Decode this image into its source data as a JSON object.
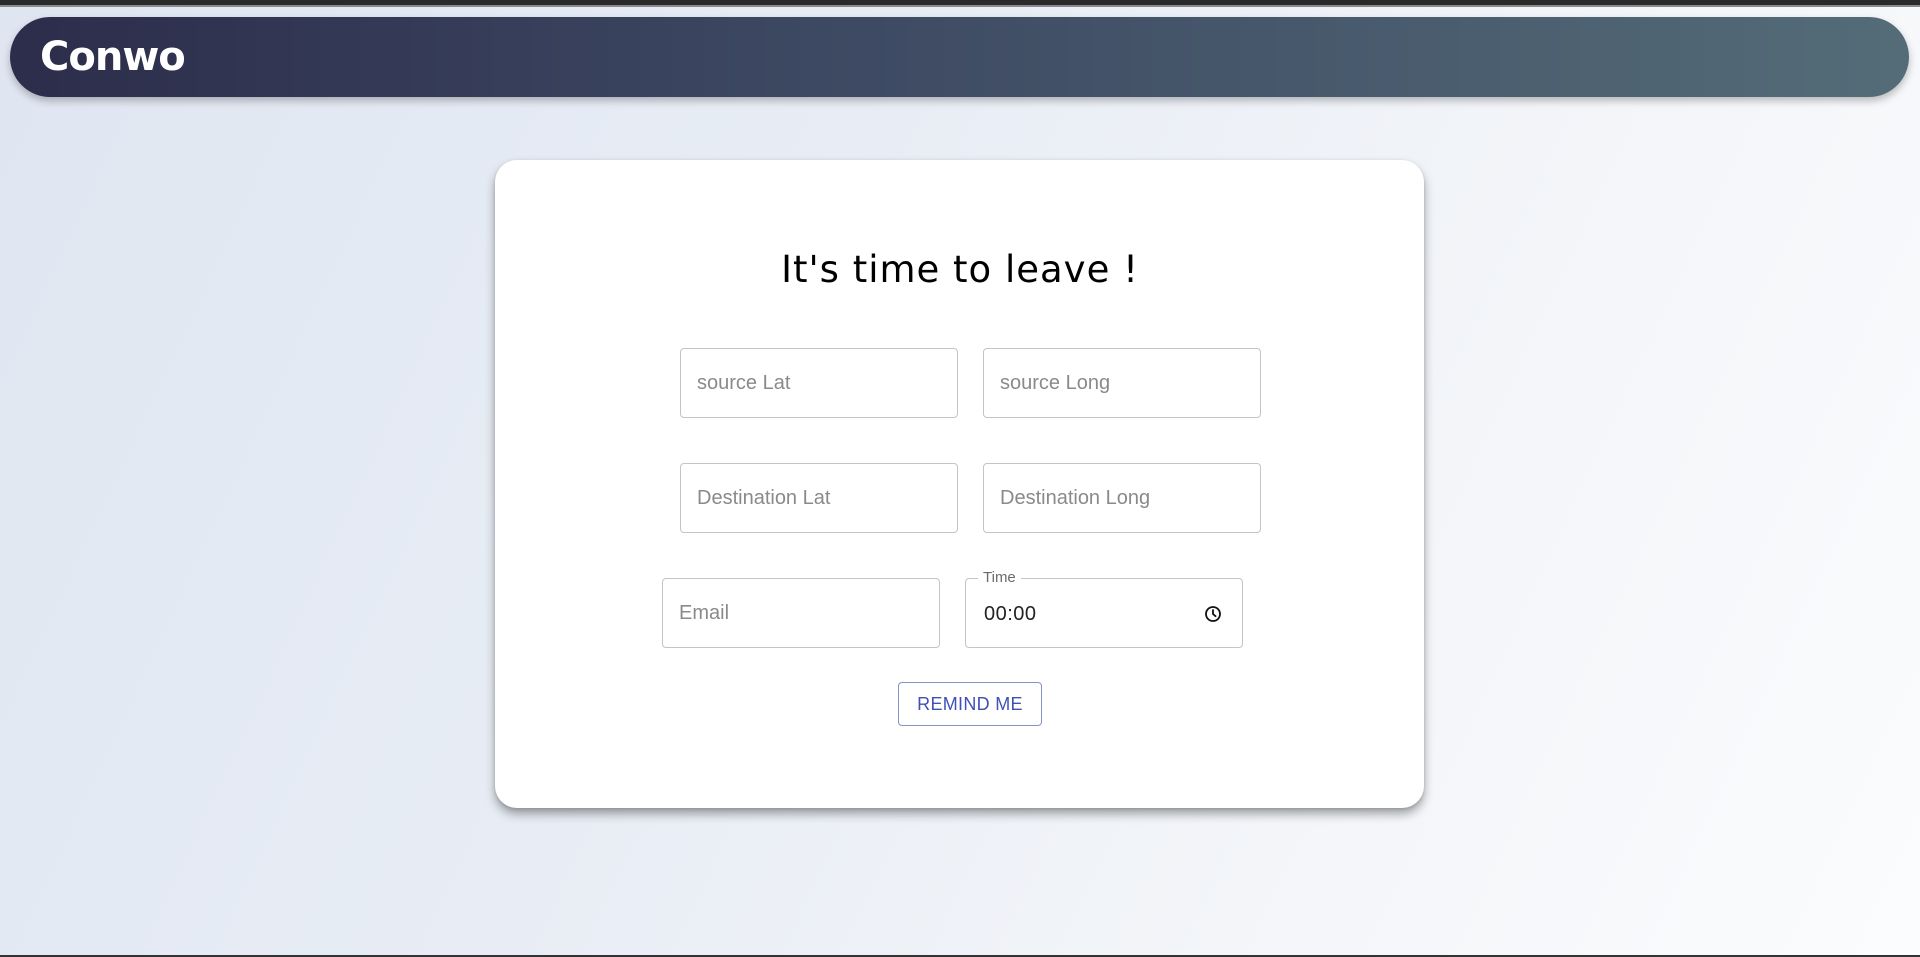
{
  "app": {
    "brand": "Conwo"
  },
  "form": {
    "title": "It's time to leave !",
    "source_lat": {
      "placeholder": "source Lat",
      "value": ""
    },
    "source_long": {
      "placeholder": "source Long",
      "value": ""
    },
    "destination_lat": {
      "placeholder": "Destination Lat",
      "value": ""
    },
    "destination_long": {
      "placeholder": "Destination Long",
      "value": ""
    },
    "email": {
      "placeholder": "Email",
      "value": ""
    },
    "time": {
      "label": "Time",
      "value": "00:00",
      "icon": "clock-icon"
    },
    "submit_label": "REMIND ME"
  },
  "colors": {
    "accent": "#3f51b5",
    "appbar_start": "#2c2d4b",
    "appbar_end": "#546c78"
  }
}
